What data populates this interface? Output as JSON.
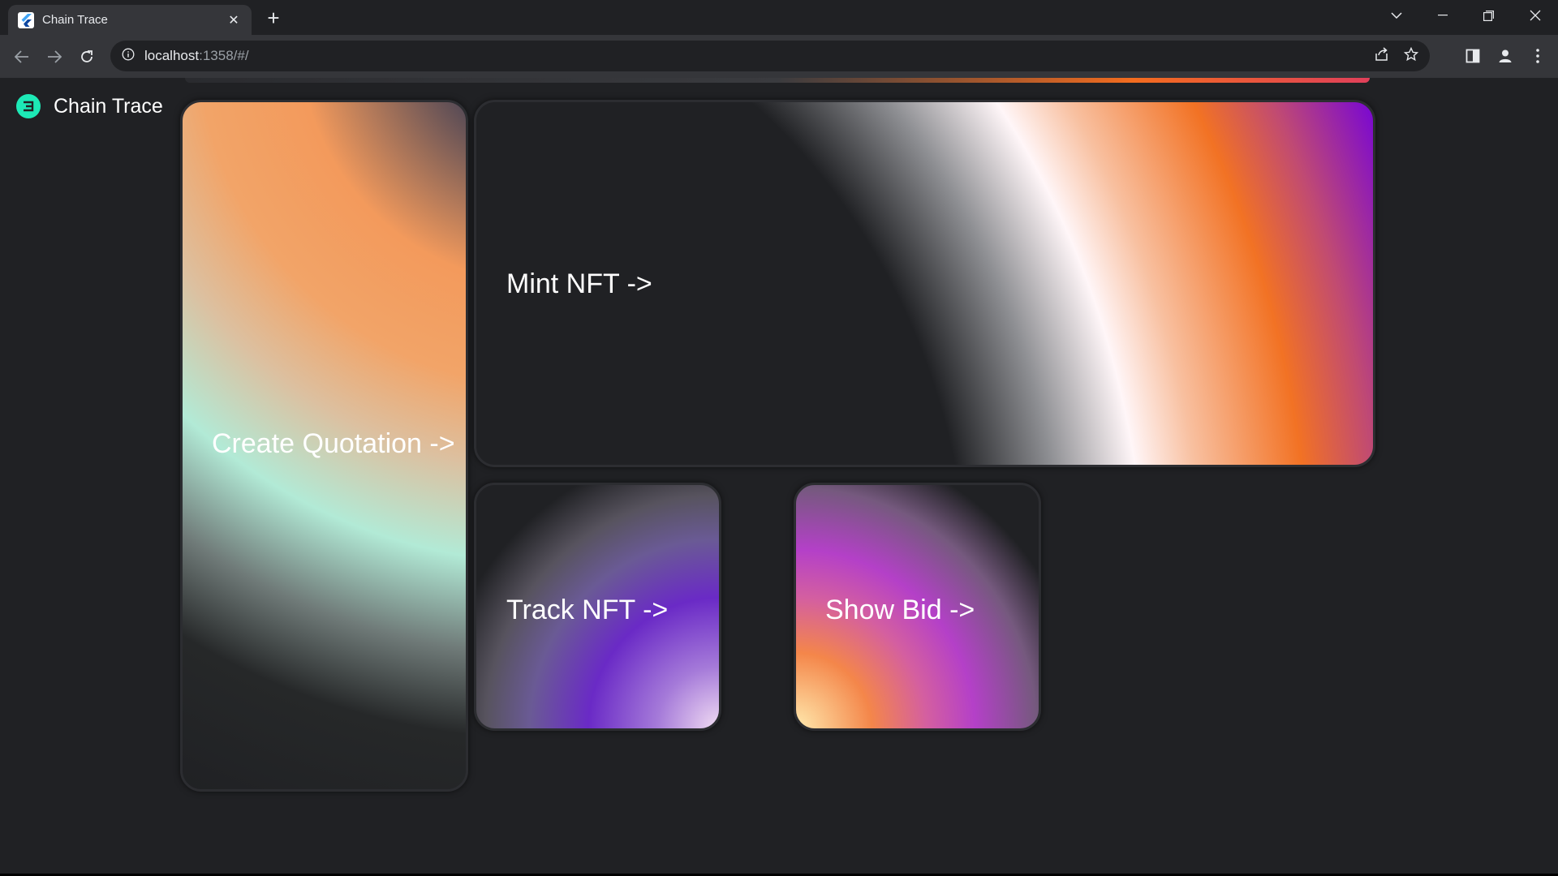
{
  "browser": {
    "tab_title": "Chain Trace",
    "url_host": "localhost",
    "url_rest": ":1358/#/"
  },
  "app": {
    "brand_name": "Chain Trace",
    "accent_color": "#1de9b6"
  },
  "cards": {
    "create_quotation": "Create Quotation ->",
    "mint_nft": "Mint NFT ->",
    "track_nft": "Track NFT ->",
    "show_bid": "Show Bid ->"
  }
}
